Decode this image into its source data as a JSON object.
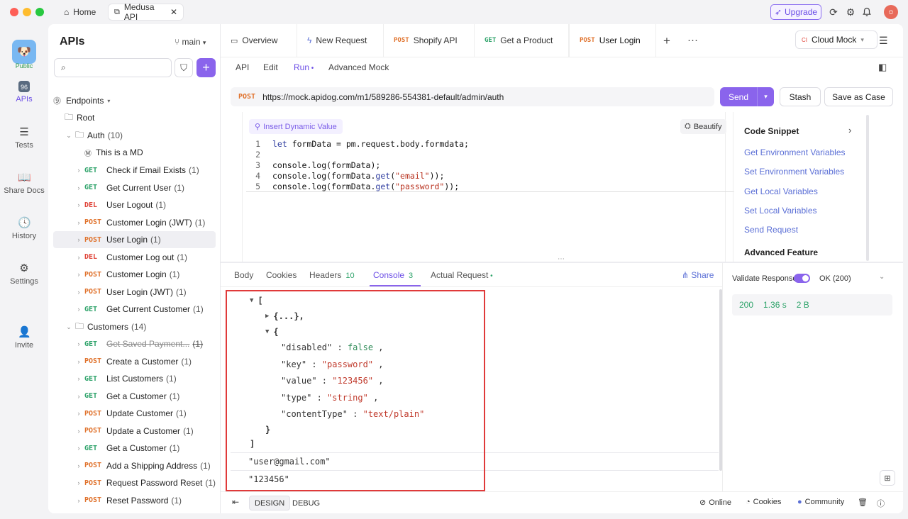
{
  "titlebar": {
    "home_tab": "Home",
    "project_tab": "Medusa API",
    "upgrade": "Upgrade"
  },
  "rail": {
    "project_badge": "Public",
    "items": [
      {
        "label": "APIs",
        "icon": "apis-icon"
      },
      {
        "label": "Tests",
        "icon": "tests-icon"
      },
      {
        "label": "Share Docs",
        "icon": "book-icon"
      },
      {
        "label": "History",
        "icon": "clock-icon"
      },
      {
        "label": "Settings",
        "icon": "gear-icon"
      },
      {
        "label": "Invite",
        "icon": "add-user-icon"
      }
    ]
  },
  "sidebar": {
    "title": "APIs",
    "branch": "main",
    "endpoints_label": "Endpoints",
    "root_label": "Root",
    "folders": {
      "auth": {
        "name": "Auth",
        "count": "(10)"
      },
      "customers": {
        "name": "Customers",
        "count": "(14)"
      }
    },
    "md_doc": "This is a MD",
    "auth_items": [
      {
        "method": "GET",
        "name": "Check if Email Exists",
        "count": "(1)"
      },
      {
        "method": "GET",
        "name": "Get Current User",
        "count": "(1)"
      },
      {
        "method": "DEL",
        "name": "User Logout",
        "count": "(1)"
      },
      {
        "method": "POST",
        "name": "Customer Login (JWT)",
        "count": "(1)"
      },
      {
        "method": "POST",
        "name": "User Login",
        "count": "(1)"
      },
      {
        "method": "DEL",
        "name": "Customer Log out",
        "count": "(1)"
      },
      {
        "method": "POST",
        "name": "Customer Login",
        "count": "(1)"
      },
      {
        "method": "POST",
        "name": "User Login (JWT)",
        "count": "(1)"
      },
      {
        "method": "GET",
        "name": "Get Current Customer",
        "count": "(1)"
      }
    ],
    "customer_items": [
      {
        "method": "GET",
        "name": "Get Saved Payment...",
        "count": "(1)"
      },
      {
        "method": "POST",
        "name": "Create a Customer",
        "count": "(1)"
      },
      {
        "method": "GET",
        "name": "List Customers",
        "count": "(1)"
      },
      {
        "method": "GET",
        "name": "Get a Customer",
        "count": "(1)"
      },
      {
        "method": "POST",
        "name": "Update Customer",
        "count": "(1)"
      },
      {
        "method": "POST",
        "name": "Update a Customer",
        "count": "(1)"
      },
      {
        "method": "GET",
        "name": "Get a Customer",
        "count": "(1)"
      },
      {
        "method": "POST",
        "name": "Add a Shipping Address",
        "count": "(1)"
      },
      {
        "method": "POST",
        "name": "Request Password Reset",
        "count": "(1)"
      },
      {
        "method": "POST",
        "name": "Reset Password",
        "count": "(1)"
      }
    ]
  },
  "doc_tabs": [
    {
      "method": "",
      "label": "Overview"
    },
    {
      "method": "",
      "label": "New Request"
    },
    {
      "method": "POST",
      "label": "Shopify API"
    },
    {
      "method": "GET",
      "label": "Get a Product"
    },
    {
      "method": "POST",
      "label": "User Login"
    }
  ],
  "environment": {
    "badge": "CI",
    "name": "Cloud Mock"
  },
  "sub_tabs": [
    "API",
    "Edit",
    "Run",
    "Advanced Mock"
  ],
  "request": {
    "method": "POST",
    "url": "https://mock.apidog.com/m1/589286-554381-default/admin/auth",
    "send": "Send",
    "stash": "Stash",
    "save_case": "Save as Case"
  },
  "editor": {
    "insert_dynamic": "Insert Dynamic Value",
    "beautify": "Beautify",
    "lines": [
      "1",
      "2",
      "3",
      "4",
      "5"
    ]
  },
  "snippets": {
    "title": "Code Snippet",
    "items": [
      "Get Environment Variables",
      "Set Environment Variables",
      "Get Local Variables",
      "Set Local Variables",
      "Send Request"
    ],
    "advanced": "Advanced Feature"
  },
  "response_tabs": {
    "body": "Body",
    "cookies": "Cookies",
    "headers": "Headers",
    "headers_count": "10",
    "console": "Console",
    "console_count": "3",
    "actual_request": "Actual Request",
    "share": "Share"
  },
  "console": {
    "array_open": "[",
    "collapsed": "{...},",
    "obj_open": "{",
    "fields": [
      {
        "key": "\"disabled\"",
        "value": "false",
        "type": "bool"
      },
      {
        "key": "\"key\"",
        "value": "\"password\"",
        "type": "str"
      },
      {
        "key": "\"value\"",
        "value": "\"123456\"",
        "type": "str"
      },
      {
        "key": "\"type\"",
        "value": "\"string\"",
        "type": "str"
      },
      {
        "key": "\"contentType\"",
        "value": "\"text/plain\"",
        "type": "str"
      }
    ],
    "obj_close": "}",
    "array_close": "]",
    "log1": "\"user@gmail.com\"",
    "log2": "\"123456\""
  },
  "validation": {
    "label": "Validate Response",
    "status": "OK (200)",
    "code": "200",
    "time": "1.36 s",
    "size": "2 B"
  },
  "footer": {
    "design": "DESIGN",
    "debug": "DEBUG",
    "online": "Online",
    "cookies": "Cookies",
    "community": "Community"
  },
  "colors": {
    "accent": "#8a64ec",
    "get": "#2ea36a",
    "post": "#e0722c",
    "del": "#e0453a",
    "highlight_box": "#e03a3a"
  }
}
